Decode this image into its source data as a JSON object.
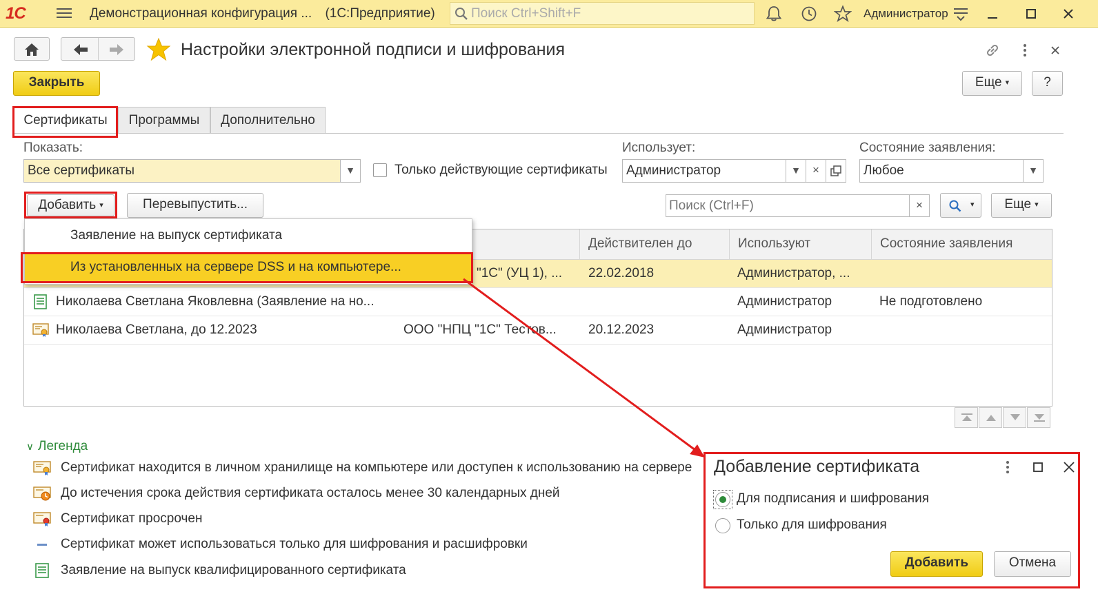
{
  "app": {
    "logo": "1С",
    "title": "Демонстрационная конфигурация ...",
    "platform": "(1С:Предприятие)",
    "search_placeholder": "Поиск Ctrl+Shift+F",
    "user": "Администратор"
  },
  "form": {
    "title": "Настройки электронной подписи и шифрования",
    "close_label": "Закрыть",
    "more_label": "Еще",
    "help_label": "?"
  },
  "tabs": [
    {
      "label": "Сертификаты",
      "active": true
    },
    {
      "label": "Программы",
      "active": false
    },
    {
      "label": "Дополнительно",
      "active": false
    }
  ],
  "filters": {
    "show_label": "Показать:",
    "show_value": "Все сертификаты",
    "only_valid_label": "Только действующие сертификаты",
    "only_valid_checked": false,
    "user_label": "Использует:",
    "user_value": "Администратор",
    "state_label": "Состояние заявления:",
    "state_value": "Любое"
  },
  "toolbar": {
    "add_label": "Добавить",
    "reissue_label": "Перевыпустить...",
    "search_placeholder": "Поиск (Ctrl+F)",
    "more_label": "Еще"
  },
  "add_menu": {
    "items": [
      {
        "label": "Заявление на выпуск сертификата",
        "active": false
      },
      {
        "label": "Из установленных на сервере DSS и на компьютере...",
        "active": true
      }
    ]
  },
  "table": {
    "columns": [
      "Действителен до",
      "Используют",
      "Состояние заявления"
    ],
    "rows": [
      {
        "name": "",
        "issuer": "\"1С\" (УЦ 1), ...",
        "valid_to": "22.02.2018",
        "users": "Администратор, ...",
        "state": "",
        "selected": true
      },
      {
        "name": "Николаева Светлана Яковлевна (Заявление на но...",
        "issuer": "",
        "valid_to": "",
        "users": "Администратор",
        "state": "Не подготовлено",
        "selected": false
      },
      {
        "name": "Николаева Светлана, до 12.2023",
        "issuer": "ООО \"НПЦ \"1С\" Тестов...",
        "valid_to": "20.12.2023",
        "users": "Администратор",
        "state": "",
        "selected": false
      }
    ]
  },
  "legend": {
    "title": "Легенда",
    "items": [
      {
        "icon": "certificate-icon",
        "text": "Сертификат находится в личном хранилище на компьютере или доступен к использованию на сервере"
      },
      {
        "icon": "certificate-expiring-icon",
        "text": "До истечения срока действия сертификата осталось менее 30 календарных дней"
      },
      {
        "icon": "certificate-expired-icon",
        "text": "Сертификат просрочен"
      },
      {
        "icon": "encryption-only-icon",
        "text": "Сертификат может использоваться только для шифрования и расшифровки"
      },
      {
        "icon": "application-icon",
        "text": "Заявление на выпуск квалифицированного сертификата"
      }
    ]
  },
  "dialog": {
    "title": "Добавление сертификата",
    "options": [
      {
        "label": "Для подписания и шифрования",
        "checked": true
      },
      {
        "label": "Только для шифрования",
        "checked": false
      }
    ],
    "add_label": "Добавить",
    "cancel_label": "Отмена"
  },
  "colors": {
    "accent_yellow": "#f8cf24",
    "titlebar": "#fbeb9c",
    "highlight_red": "#e21d1d",
    "legend_green": "#2e8b3a",
    "selected_row": "#fbefb4"
  }
}
